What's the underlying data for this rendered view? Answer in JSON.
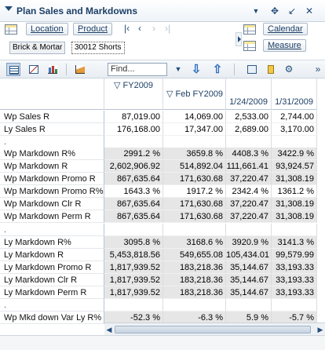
{
  "window": {
    "title": "Plan Sales and Markdowns"
  },
  "dimensions": {
    "row_dim": "Location",
    "col_dim": "Product",
    "row_crumb": "Brick & Mortar",
    "col_crumb": "30012 Shorts",
    "right_dim_1": "Calendar",
    "right_dim_2": "Measure"
  },
  "toolbar": {
    "find_placeholder": "Find..."
  },
  "columns": [
    {
      "header": "FY2009",
      "expand": "▽",
      "width": 75
    },
    {
      "header": "Feb FY2009",
      "expand": "▽",
      "width": 80
    },
    {
      "header": "1/24/2009",
      "expand": "",
      "width": 58
    },
    {
      "header": "1/31/2009",
      "expand": "",
      "width": 58
    }
  ],
  "rows": [
    {
      "label": "Wp Sales R",
      "values": [
        "87,019.00",
        "14,069.00",
        "2,533.00",
        "2,744.00"
      ],
      "shade": false
    },
    {
      "label": "Ly Sales R",
      "values": [
        "176,168.00",
        "17,347.00",
        "2,689.00",
        "3,170.00"
      ],
      "shade": false
    },
    {
      "label": ".",
      "values": [
        "",
        "",
        "",
        ""
      ],
      "shade": false,
      "blank": true
    },
    {
      "label": "Wp Markdown R%",
      "values": [
        "2991.2 %",
        "3659.8 %",
        "4408.3 %",
        "3422.9 %"
      ],
      "shade": true
    },
    {
      "label": "Wp Markdown R",
      "values": [
        "2,602,906.92",
        "514,892.04",
        "111,661.41",
        "93,924.57"
      ],
      "shade": true
    },
    {
      "label": "Wp Markdown Promo R",
      "values": [
        "867,635.64",
        "171,630.68",
        "37,220.47",
        "31,308.19"
      ],
      "shade": true
    },
    {
      "label": "Wp Markdown Promo R%",
      "values": [
        "1643.3 %",
        "1917.2 %",
        "2342.4 %",
        "1361.2 %"
      ],
      "shade": false
    },
    {
      "label": "Wp Markdown Clr R",
      "values": [
        "867,635.64",
        "171,630.68",
        "37,220.47",
        "31,308.19"
      ],
      "shade": true
    },
    {
      "label": "Wp Markdown Perm R",
      "values": [
        "867,635.64",
        "171,630.68",
        "37,220.47",
        "31,308.19"
      ],
      "shade": true
    },
    {
      "label": ".",
      "values": [
        "",
        "",
        "",
        ""
      ],
      "shade": false,
      "blank": true
    },
    {
      "label": "Ly Markdown R%",
      "values": [
        "3095.8 %",
        "3168.6 %",
        "3920.9 %",
        "3141.3 %"
      ],
      "shade": true
    },
    {
      "label": "Ly Markdown R",
      "values": [
        "5,453,818.56",
        "549,655.08",
        "105,434.01",
        "99,579.99"
      ],
      "shade": true
    },
    {
      "label": "Ly Markdown Promo R",
      "values": [
        "1,817,939.52",
        "183,218.36",
        "35,144.67",
        "33,193.33"
      ],
      "shade": true
    },
    {
      "label": "Ly Markdown Clr R",
      "values": [
        "1,817,939.52",
        "183,218.36",
        "35,144.67",
        "33,193.33"
      ],
      "shade": true
    },
    {
      "label": "Ly Markdown Perm R",
      "values": [
        "1,817,939.52",
        "183,218.36",
        "35,144.67",
        "33,193.33"
      ],
      "shade": true
    },
    {
      "label": ".",
      "values": [
        "",
        "",
        "",
        ""
      ],
      "shade": false,
      "blank": true
    },
    {
      "label": "Wp Mkd down Var Ly R%",
      "values": [
        "-52.3 %",
        "-6.3 %",
        "5.9 %",
        "-5.7 %"
      ],
      "shade": true
    }
  ],
  "icons": [
    "collapse-icon",
    "move-icon",
    "minimize-icon",
    "close-icon",
    "grid-icon",
    "chart-icon",
    "bar-chart-icon",
    "area-chart-icon",
    "down-arrow-icon",
    "up-arrow-icon",
    "export-icon",
    "calculator-icon",
    "settings-icon"
  ],
  "colors": {
    "title": "#1c3f66",
    "accent": "#224d7a",
    "shade": "#e6e6e6"
  }
}
